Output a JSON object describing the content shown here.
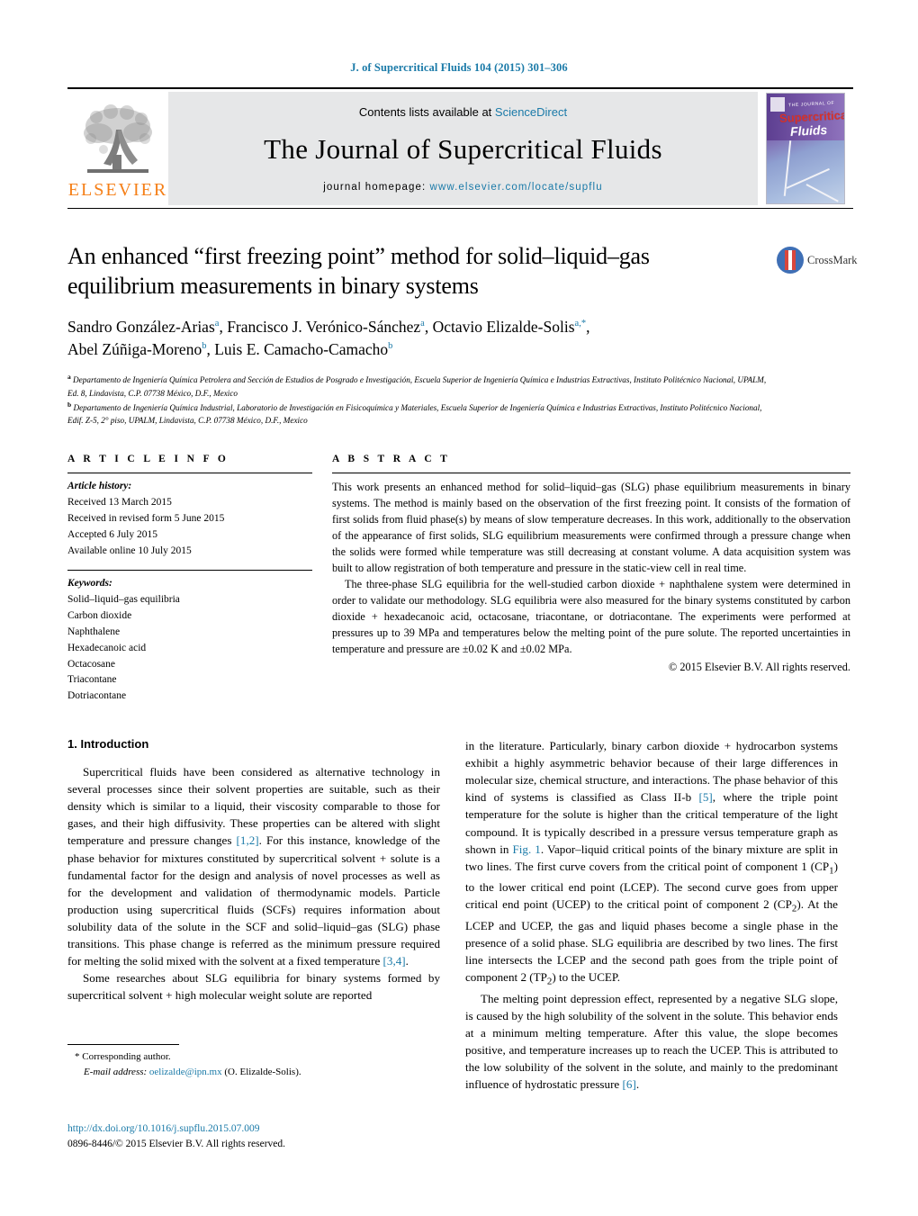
{
  "running_head": "J. of Supercritical Fluids 104 (2015) 301–306",
  "masthead": {
    "publisher_name": "ELSEVIER",
    "contents_prefix": "Contents lists available at ",
    "contents_link": "ScienceDirect",
    "journal_title": "The Journal of Supercritical Fluids",
    "homepage_label": "journal homepage: ",
    "homepage_url": "www.elsevier.com/locate/supflu",
    "cover": {
      "line1": "THE JOURNAL OF",
      "line2": "Supercritical",
      "line3": "Fluids"
    }
  },
  "crossmark": {
    "label": "CrossMark"
  },
  "article": {
    "title": "An enhanced “first freezing point” method for solid–liquid–gas equilibrium measurements in binary systems",
    "authors_line1_part1": "Sandro González-Arias",
    "authors_sup1": "a",
    "authors_line1_part2": ", Francisco J. Verónico-Sánchez",
    "authors_sup2": "a",
    "authors_line1_part3": ", Octavio Elizalde-Solis",
    "authors_sup3": "a,*",
    "authors_line2_part1": "Abel Zúñiga-Moreno",
    "authors_sup4": "b",
    "authors_line2_part2": ", Luis E. Camacho-Camacho",
    "authors_sup5": "b",
    "affiliation_a_marker": "a",
    "affiliation_a": "Departamento de Ingeniería Química Petrolera and Sección de Estudios de Posgrado e Investigación, Escuela Superior de Ingeniería Química e Industrias Extractivas, Instituto Politécnico Nacional, UPALM, Ed. 8, Lindavista, C.P. 07738 México, D.F., Mexico",
    "affiliation_b_marker": "b",
    "affiliation_b": "Departamento de Ingeniería Química Industrial, Laboratorio de Investigación en Fisicoquímica y Materiales, Escuela Superior de Ingeniería Química e Industrias Extractivas, Instituto Politécnico Nacional, Edif. Z-5, 2° piso, UPALM, Lindavista, C.P. 07738 México, D.F., Mexico"
  },
  "article_info": {
    "heading": "A R T I C L E   I N F O",
    "history_label": "Article history:",
    "history": [
      "Received 13 March 2015",
      "Received in revised form 5 June 2015",
      "Accepted 6 July 2015",
      "Available online 10 July 2015"
    ],
    "keywords_label": "Keywords:",
    "keywords": [
      "Solid–liquid–gas equilibria",
      "Carbon dioxide",
      "Naphthalene",
      "Hexadecanoic acid",
      "Octacosane",
      "Triacontane",
      "Dotriacontane"
    ]
  },
  "abstract": {
    "heading": "A B S T R A C T",
    "paragraph1": "This work presents an enhanced method for solid–liquid–gas (SLG) phase equilibrium measurements in binary systems. The method is mainly based on the observation of the first freezing point. It consists of the formation of first solids from fluid phase(s) by means of slow temperature decreases. In this work, additionally to the observation of the appearance of first solids, SLG equilibrium measurements were confirmed through a pressure change when the solids were formed while temperature was still decreasing at constant volume. A data acquisition system was built to allow registration of both temperature and pressure in the static-view cell in real time.",
    "paragraph2": "The three-phase SLG equilibria for the well-studied carbon dioxide + naphthalene system were determined in order to validate our methodology. SLG equilibria were also measured for the binary systems constituted by carbon dioxide + hexadecanoic acid, octacosane, triacontane, or dotriacontane. The experiments were performed at pressures up to 39 MPa and temperatures below the melting point of the pure solute. The reported uncertainties in temperature and pressure are ±0.02 K and ±0.02 MPa.",
    "copyright": "© 2015 Elsevier B.V. All rights reserved."
  },
  "body": {
    "section_heading": "1. Introduction",
    "left_p1_a": "Supercritical fluids have been considered as alternative technology in several processes since their solvent properties are suitable, such as their density which is similar to a liquid, their viscosity comparable to those for gases, and their high diffusivity. These properties can be altered with slight temperature and pressure changes ",
    "left_p1_cite1": "[1,2]",
    "left_p1_b": ". For this instance, knowledge of the phase behavior for mixtures constituted by supercritical solvent + solute is a fundamental factor for the design and analysis of novel processes as well as for the development and validation of thermodynamic models. Particle production using supercritical fluids (SCFs) requires information about solubility data of the solute in the SCF and solid–liquid–gas (SLG) phase transitions. This phase change is referred as the minimum pressure required for melting the solid mixed with the solvent at a fixed temperature ",
    "left_p1_cite2": "[3,4]",
    "left_p1_c": ".",
    "left_p2": "Some researches about SLG equilibria for binary systems formed by supercritical solvent + high molecular weight solute are reported",
    "right_p1_a": "in the literature. Particularly, binary carbon dioxide + hydrocarbon systems exhibit a highly asymmetric behavior because of their large differences in molecular size, chemical structure, and interactions. The phase behavior of this kind of systems is classified as Class II-b ",
    "right_p1_cite1": "[5]",
    "right_p1_b": ", where the triple point temperature for the solute is higher than the critical temperature of the light compound. It is typically described in a pressure versus temperature graph as shown in ",
    "right_p1_figref": "Fig. 1",
    "right_p1_c": ". Vapor–liquid critical points of the binary mixture are split in two lines. The first curve covers from the critical point of component 1 (CP",
    "right_p1_sub1": "1",
    "right_p1_d": ") to the lower critical end point (LCEP). The second curve goes from upper critical end point (UCEP) to the critical point of component 2 (CP",
    "right_p1_sub2": "2",
    "right_p1_e": "). At the LCEP and UCEP, the gas and liquid phases become a single phase in the presence of a solid phase. SLG equilibria are described by two lines. The first line intersects the LCEP and the second path goes from the triple point of component 2 (TP",
    "right_p1_sub3": "2",
    "right_p1_f": ") to the UCEP.",
    "right_p2_a": "The melting point depression effect, represented by a negative SLG slope, is caused by the high solubility of the solvent in the solute. This behavior ends at a minimum melting temperature. After this value, the slope becomes positive, and temperature increases up to reach the UCEP. This is attributed to the low solubility of the solvent in the solute, and mainly to the predominant influence of hydrostatic pressure ",
    "right_p2_cite": "[6]",
    "right_p2_b": "."
  },
  "footnote": {
    "corresponding": "* Corresponding author.",
    "email_label": "E-mail address:",
    "email": "oelizalde@ipn.mx",
    "email_owner": "(O. Elizalde-Solis)."
  },
  "doc_footer": {
    "doi": "http://dx.doi.org/10.1016/j.supflu.2015.07.009",
    "issn_line": "0896-8446/© 2015 Elsevier B.V. All rights reserved."
  },
  "colors": {
    "link_blue": "#1a7aa8",
    "elsevier_orange": "#F57F17",
    "banner_gray": "#e6e7e8"
  }
}
